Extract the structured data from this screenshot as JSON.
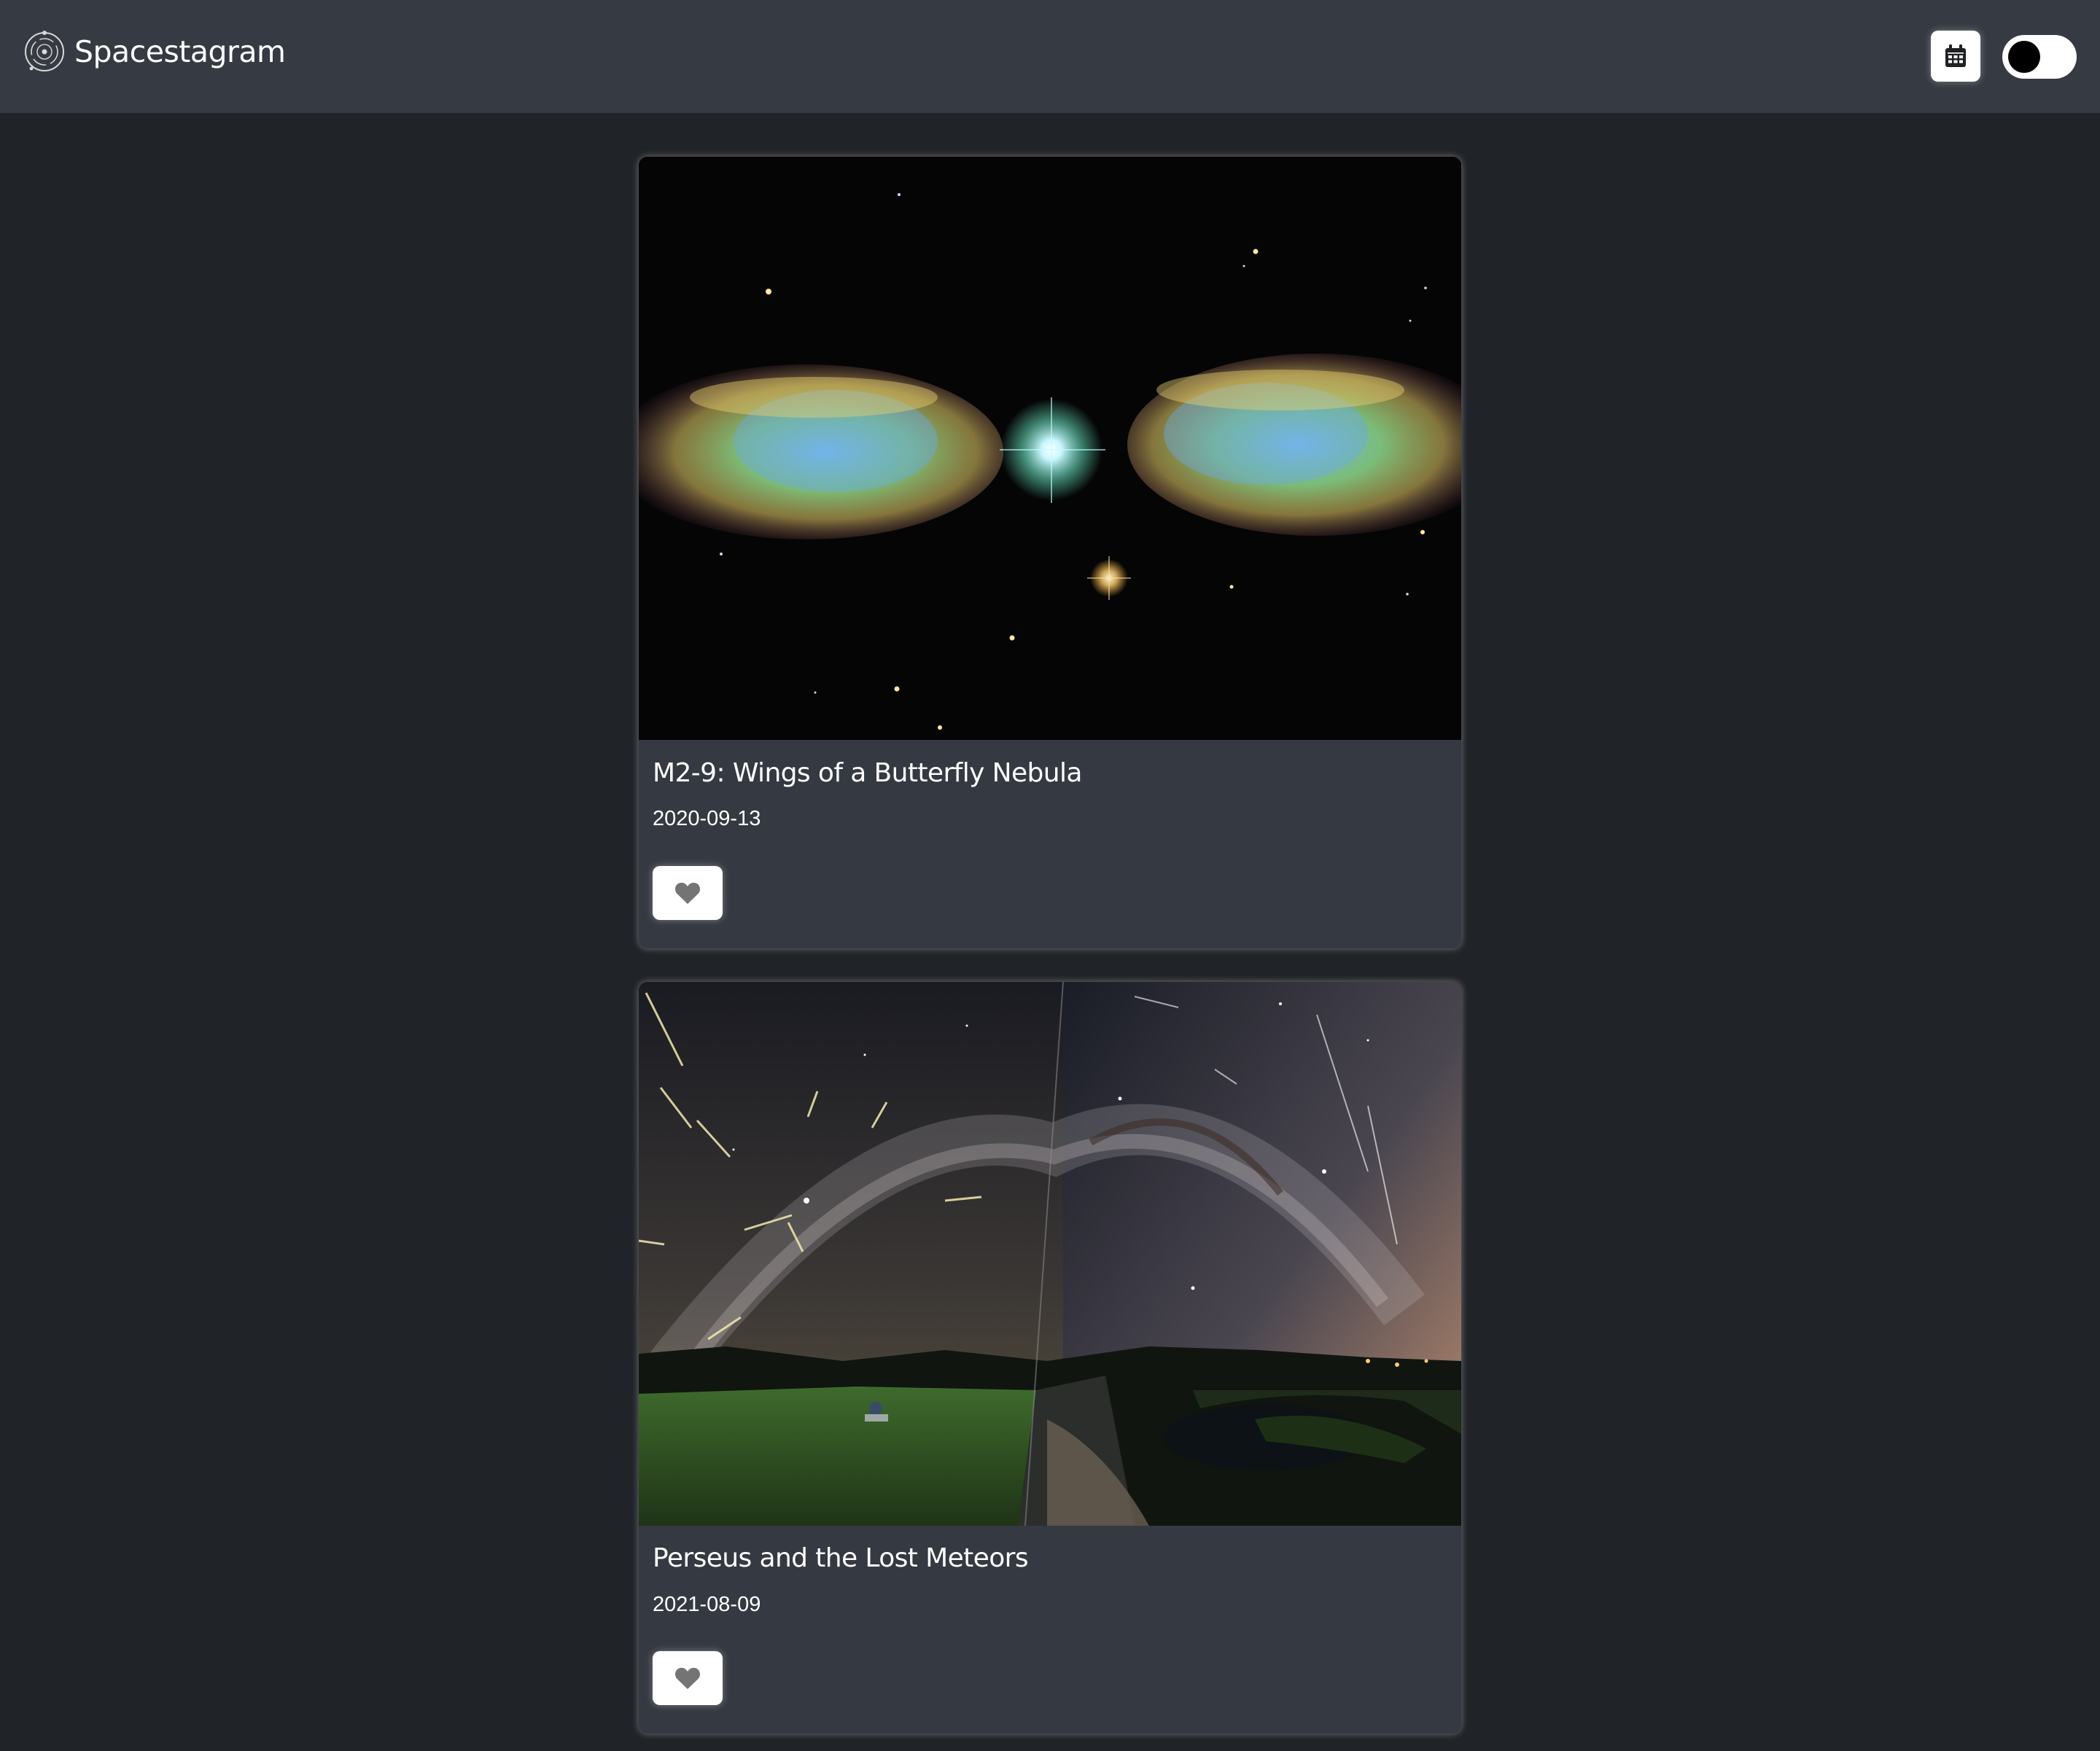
{
  "app": {
    "brand": "Spacestagram",
    "icons": {
      "logo": "galaxy-logo-icon",
      "calendar": "calendar-icon",
      "theme_toggle": "dark-mode-toggle",
      "like": "heart-icon"
    }
  },
  "posts": [
    {
      "title": "M2-9: Wings of a Butterfly Nebula",
      "date": "2020-09-13",
      "liked": false,
      "image": "nebula-photo"
    },
    {
      "title": "Perseus and the Lost Meteors",
      "date": "2021-08-09",
      "liked": false,
      "image": "meteor-photo"
    }
  ],
  "colors": {
    "navbar": "#363a42",
    "page_bg": "#202327",
    "card_bg": "#353941",
    "text": "#ffffff"
  }
}
